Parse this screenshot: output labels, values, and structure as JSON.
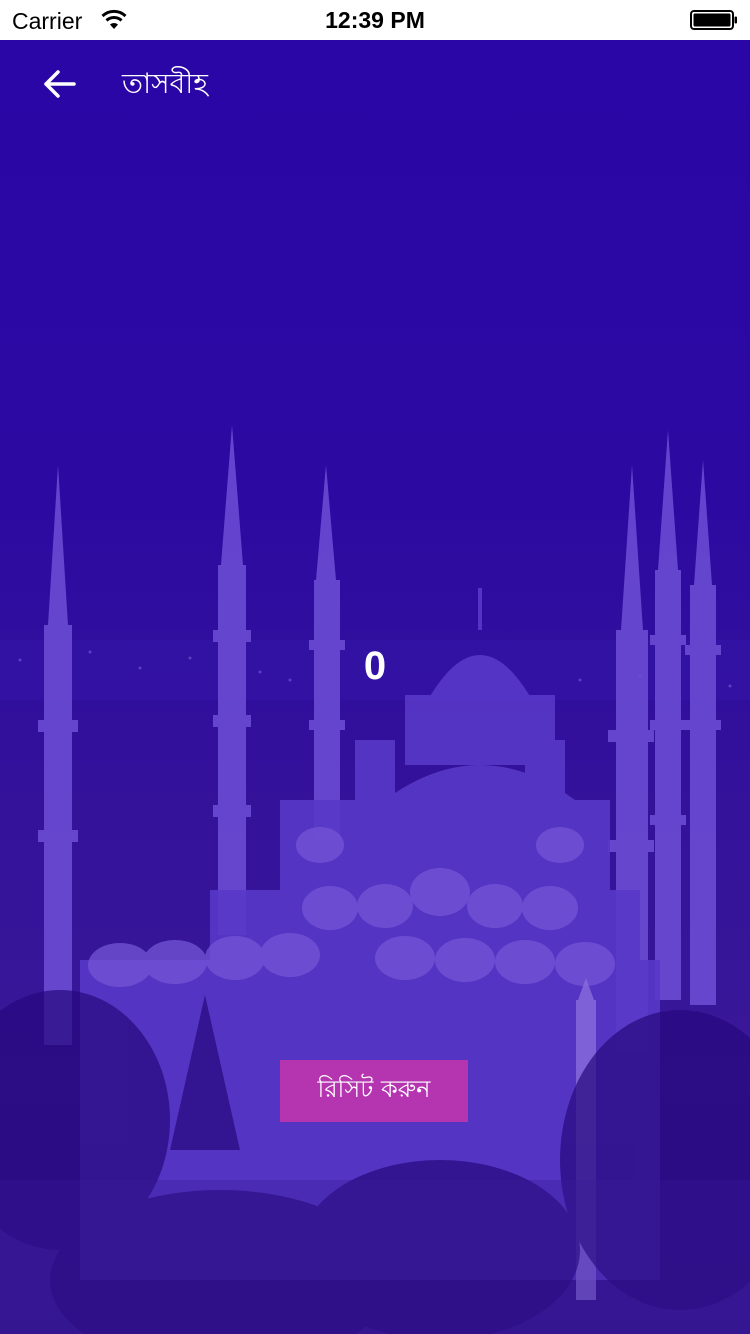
{
  "status_bar": {
    "carrier": "Carrier",
    "time": "12:39 PM",
    "icons": [
      "wifi-icon",
      "battery-icon"
    ]
  },
  "app_bar": {
    "back_icon": "arrow-left-icon",
    "title": "তাসবীহ"
  },
  "counter": {
    "value": "0"
  },
  "reset_button": {
    "label": "রিসিট করুন"
  },
  "colors": {
    "background": "#2a0a9c",
    "overlay": "#2c08a8",
    "reset_button": "#b535b0",
    "text": "#ffffff"
  }
}
